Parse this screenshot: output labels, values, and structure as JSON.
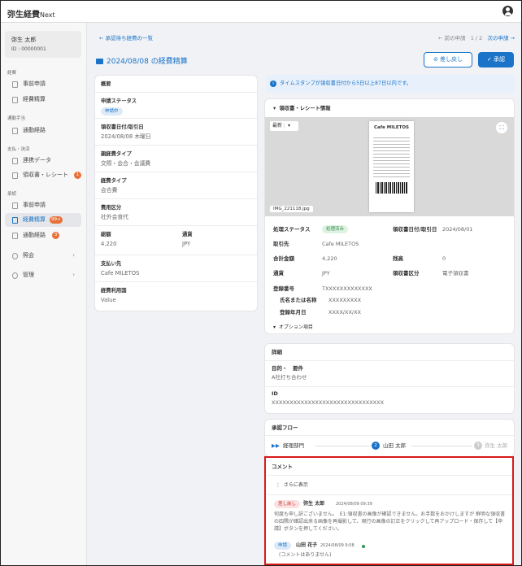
{
  "app": {
    "name": "弥生経費",
    "name_suffix": "Next"
  },
  "user": {
    "name": "弥生 太郎",
    "id": "ID : 00000001"
  },
  "sidebar": {
    "sec_expense": "経費",
    "expense_request": "事前申請",
    "expense_settle": "経費精算",
    "sec_commute": "通勤手当",
    "commute_route": "通勤経路",
    "sec_payment": "支払・決済",
    "linked_data": "連携データ",
    "receipts": "領収書・レシート",
    "receipts_badge": "1",
    "sec_approval": "承認",
    "appr_request": "事前申請",
    "appr_settle": "経費精算",
    "appr_settle_badge": "99+",
    "appr_commute": "通勤経路",
    "appr_commute_badge": "3",
    "inquiry": "照会",
    "admin": "管理"
  },
  "header": {
    "back": "承認待ち経費の一覧",
    "prev": "前の申請",
    "page": "1 / 2",
    "next": "次の申請",
    "title": "2024/08/08 の経費精算",
    "return_btn": "差し戻し",
    "approve_btn": "承認"
  },
  "summary": {
    "heading": "概要",
    "status_label": "申請ステータス",
    "status": "申請中",
    "date_label": "領収書日付/取引日",
    "date": "2024/08/08 木曜日",
    "type_label": "親経費タイプ",
    "type": "交際・会合・会議費",
    "subtype_label": "経費タイプ",
    "subtype": "会合費",
    "cost_label": "費用区分",
    "cost": "社外会食代",
    "amount_label": "総額",
    "amount": "4,220",
    "currency_label": "通貨",
    "currency": "JPY",
    "payee_label": "支払い先",
    "payee": "Cafe MILETOS",
    "usage_label": "経費利用国",
    "usage": "Value"
  },
  "notice": "タイムスタンプが領収書日付から5日以上87日以内です。",
  "receipt": {
    "heading": "領収書・レシート情報",
    "sort": "最新",
    "filename": "IMG_221118.jpg",
    "store": "Cafe MILETOS",
    "proc_label": "処理ステータス",
    "proc": "処理済み",
    "rdate_label": "領収書日付/取引日",
    "rdate": "2024/08/01",
    "vendor_label": "取引先",
    "vendor": "Cafe MILETOS",
    "total_label": "合計金額",
    "total": "4,220",
    "balance_label": "残高",
    "balance": "0",
    "cur_label": "通貨",
    "cur": "JPY",
    "rtype_label": "領収書区分",
    "rtype": "電子領収書",
    "reg_label": "登録番号",
    "reg": "TXXXXXXXXXXXXX",
    "name_label": "氏名または名称",
    "name": "XXXXXXXXX",
    "regdate_label": "登録年月日",
    "regdate": "XXXX/XX/XX",
    "options": "オプション項目"
  },
  "details": {
    "heading": "詳細",
    "purpose_label": "目的・　要件",
    "purpose": "A社打ち合わせ",
    "id_label": "ID",
    "id": "XXXXXXXXXXXXXXXXXXXXXXXXXXXXXXX"
  },
  "flow": {
    "heading": "承認フロー",
    "step1": "経理部門",
    "step2_num": "2",
    "step2": "山田 太郎",
    "step3_num": "3",
    "step3": "弥生 太郎"
  },
  "comments": {
    "heading": "コメント",
    "more": "さらに表示",
    "c1_tag": "差し戻し",
    "c1_author": "弥生 太郎",
    "c1_time": "2024/08/09 09:39",
    "c1_text": "何度も申し訳ございません。　E1:領収書の画像が確認できません。お手数をおかけしますが 鮮明な領収書の四隅が確認出来る画像を再撮影して、現行の画像の訂正をクリックして再アップロード・保存して【申請】ボタンを押してください。",
    "c2_tag": "申請",
    "c2_author": "山田 花子",
    "c2_time": "2024/08/09 9:08",
    "c2_text": "(コメントはありません)"
  },
  "colors": {
    "accent": "#1a73c8",
    "alert": "#d81a1a",
    "badge": "#e8713a"
  }
}
